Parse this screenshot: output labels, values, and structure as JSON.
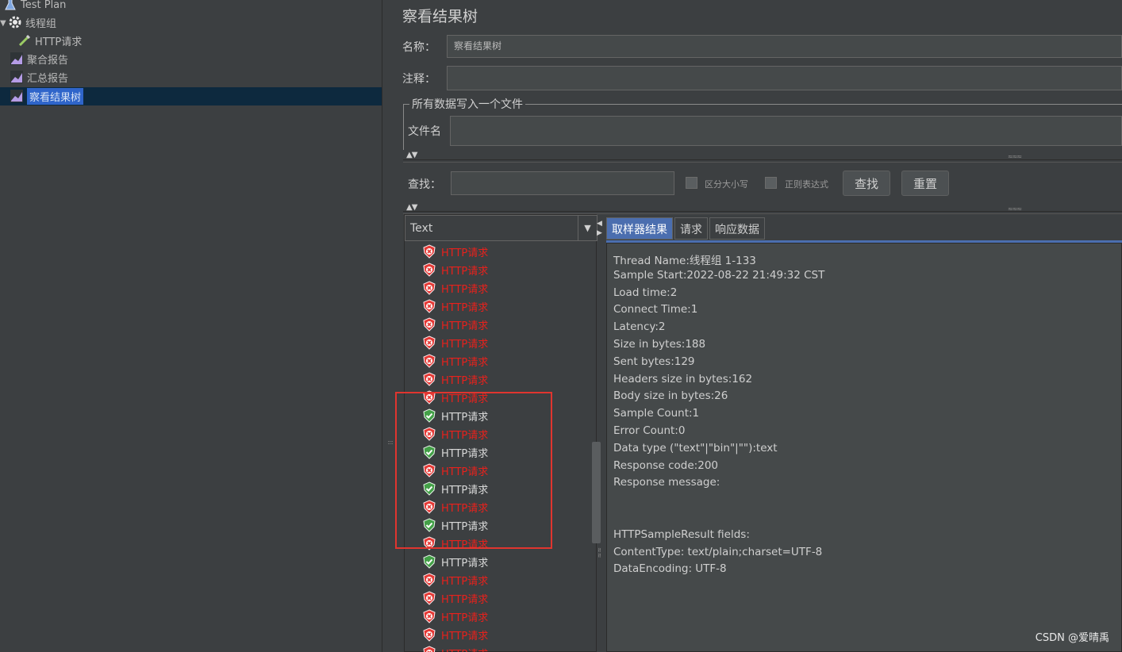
{
  "tree": {
    "items": [
      {
        "label": "Test Plan",
        "icon": "flask-icon"
      },
      {
        "label": "线程组",
        "icon": "gear-icon"
      },
      {
        "label": "HTTP请求",
        "icon": "pipette-icon"
      },
      {
        "label": "聚合报告",
        "icon": "chart-icon"
      },
      {
        "label": "汇总报告",
        "icon": "chart-icon"
      },
      {
        "label": "察看结果树",
        "icon": "chart-icon"
      }
    ]
  },
  "panel": {
    "title": "察看结果树",
    "name_label": "名称：",
    "name_value": "察看结果树",
    "comment_label": "注释：",
    "comment_value": "",
    "file_group_title": "所有数据写入一个文件",
    "filename_label": "文件名",
    "filename_value": ""
  },
  "search": {
    "label": "查找：",
    "value": "",
    "case_sensitive_label": "区分大小写",
    "regex_label": "正则表达式",
    "find_button": "查找",
    "reset_button": "重置"
  },
  "results": {
    "renderer": "Text",
    "items": [
      {
        "label": "HTTP请求",
        "status": "fail"
      },
      {
        "label": "HTTP请求",
        "status": "fail"
      },
      {
        "label": "HTTP请求",
        "status": "fail"
      },
      {
        "label": "HTTP请求",
        "status": "fail"
      },
      {
        "label": "HTTP请求",
        "status": "fail"
      },
      {
        "label": "HTTP请求",
        "status": "fail"
      },
      {
        "label": "HTTP请求",
        "status": "fail"
      },
      {
        "label": "HTTP请求",
        "status": "fail"
      },
      {
        "label": "HTTP请求",
        "status": "fail"
      },
      {
        "label": "HTTP请求",
        "status": "ok"
      },
      {
        "label": "HTTP请求",
        "status": "fail"
      },
      {
        "label": "HTTP请求",
        "status": "ok"
      },
      {
        "label": "HTTP请求",
        "status": "fail"
      },
      {
        "label": "HTTP请求",
        "status": "ok"
      },
      {
        "label": "HTTP请求",
        "status": "fail"
      },
      {
        "label": "HTTP请求",
        "status": "ok"
      },
      {
        "label": "HTTP请求",
        "status": "fail"
      },
      {
        "label": "HTTP请求",
        "status": "ok"
      },
      {
        "label": "HTTP请求",
        "status": "fail"
      },
      {
        "label": "HTTP请求",
        "status": "fail"
      },
      {
        "label": "HTTP请求",
        "status": "fail"
      },
      {
        "label": "HTTP请求",
        "status": "fail"
      },
      {
        "label": "HTTP请求",
        "status": "fail"
      }
    ]
  },
  "detail": {
    "tabs": [
      "取样器结果",
      "请求",
      "响应数据"
    ],
    "lines": [
      "Thread Name:线程组 1-133",
      "Sample Start:2022-08-22 21:49:32 CST",
      "Load time:2",
      "Connect Time:1",
      "Latency:2",
      "Size in bytes:188",
      "Sent bytes:129",
      "Headers size in bytes:162",
      "Body size in bytes:26",
      "Sample Count:1",
      "Error Count:0",
      "Data type (\"text\"|\"bin\"|\"\"):text",
      "Response code:200",
      "Response message:",
      "",
      "",
      "HTTPSampleResult fields:",
      "ContentType: text/plain;charset=UTF-8",
      "DataEncoding: UTF-8"
    ]
  },
  "colors": {
    "fail": "#e8211c",
    "ok": "#4caf50",
    "selection": "#2f65ca",
    "highlight_box": "#e0352f"
  },
  "watermark": "CSDN @爱晴禹"
}
